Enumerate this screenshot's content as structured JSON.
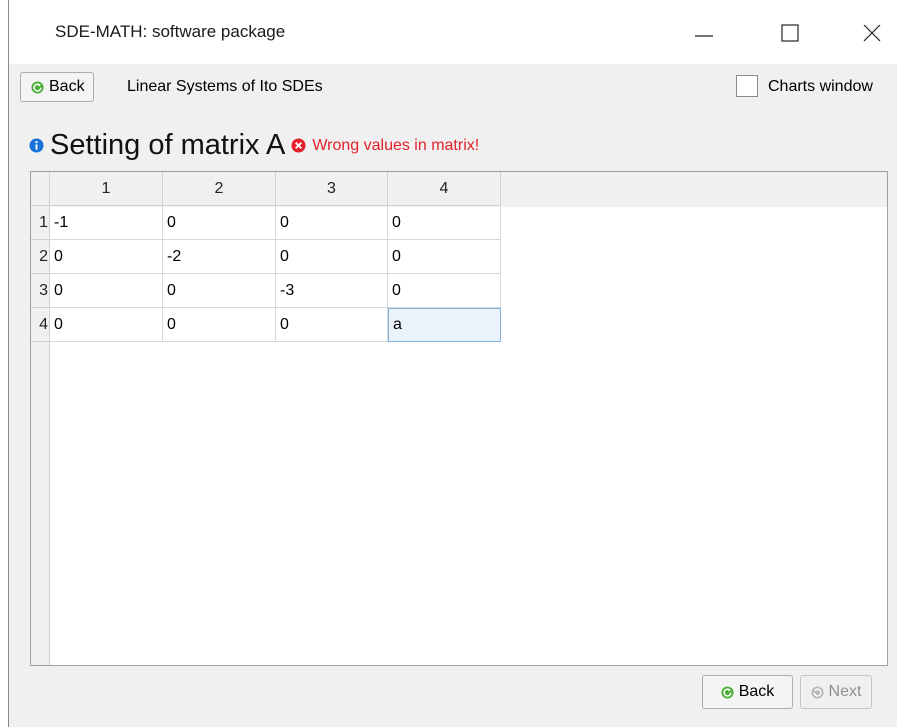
{
  "window": {
    "title": "SDE-MATH: software package"
  },
  "toolbar": {
    "back_label": "Back",
    "breadcrumb": "Linear Systems of Ito SDEs",
    "charts_checkbox_label": "Charts window",
    "charts_checked": false
  },
  "heading": {
    "title": "Setting of matrix A",
    "error": "Wrong values in matrix!"
  },
  "matrix": {
    "columns": [
      "1",
      "2",
      "3",
      "4"
    ],
    "rows": [
      {
        "label": "1",
        "cells": [
          "-1",
          "0",
          "0",
          "0"
        ]
      },
      {
        "label": "2",
        "cells": [
          "0",
          "-2",
          "0",
          "0"
        ]
      },
      {
        "label": "3",
        "cells": [
          "0",
          "0",
          "-3",
          "0"
        ]
      },
      {
        "label": "4",
        "cells": [
          "0",
          "0",
          "0",
          "a"
        ]
      }
    ],
    "selected_cell": {
      "row": 4,
      "col": 4
    }
  },
  "footer": {
    "back_label": "Back",
    "next_label": "Next"
  },
  "colors": {
    "error": "#e4202b",
    "info_icon": "#1a73d9",
    "back_icon": "#4caf3a",
    "selection": "#7fb2df"
  },
  "icons": {
    "info": "info-circle-icon",
    "error": "error-x-circle-icon",
    "back": "arrow-left-circle-icon",
    "next": "arrow-right-circle-icon",
    "minimize": "minimize-icon",
    "maximize": "maximize-icon",
    "close": "close-icon"
  }
}
